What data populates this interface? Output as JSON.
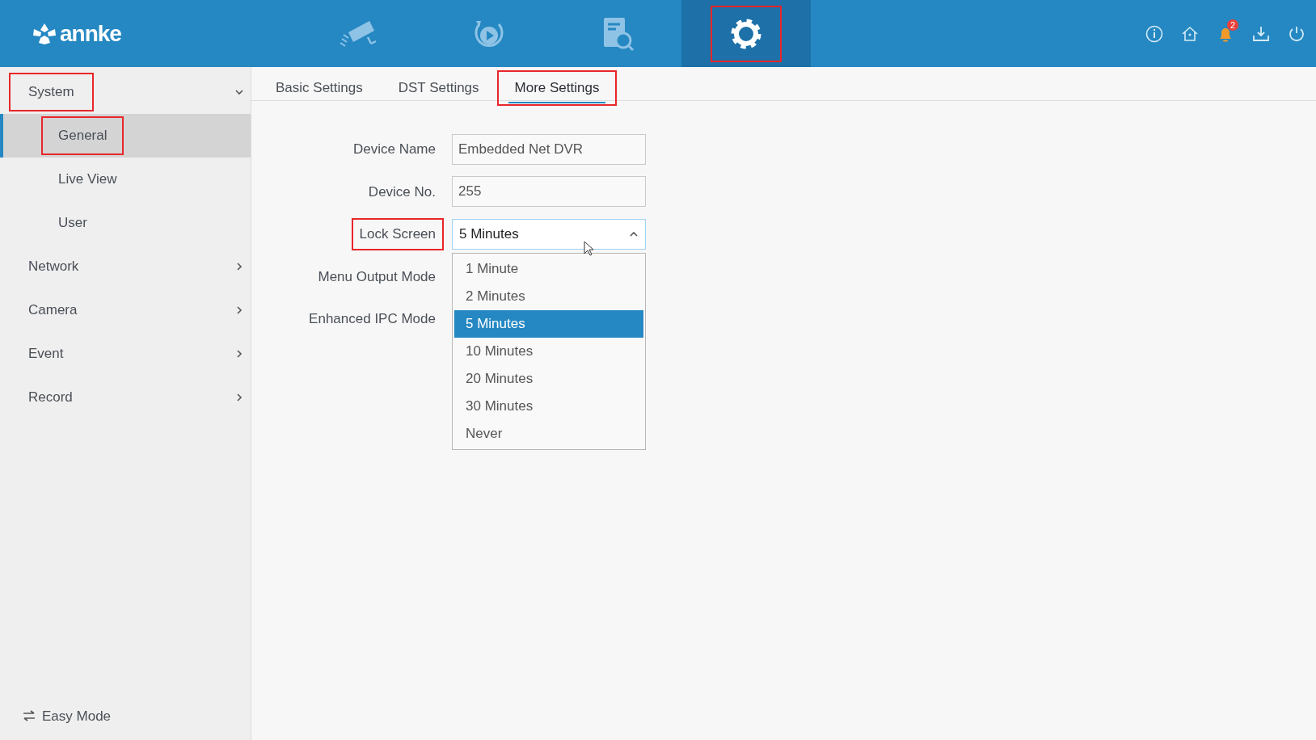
{
  "header": {
    "logo": "annke",
    "nav": [
      {
        "kind": "camera",
        "selected": false,
        "highlighted": false
      },
      {
        "kind": "playback",
        "selected": false,
        "highlighted": false
      },
      {
        "kind": "search",
        "selected": false,
        "highlighted": false
      },
      {
        "kind": "settings",
        "selected": true,
        "highlighted": true
      }
    ],
    "tools": [
      {
        "kind": "info"
      },
      {
        "kind": "home"
      },
      {
        "kind": "bell",
        "badge": "2"
      },
      {
        "kind": "download"
      },
      {
        "kind": "power"
      }
    ]
  },
  "sidebar": {
    "items": [
      {
        "label": "System",
        "expanded": true,
        "highlighted": true,
        "children": [
          {
            "label": "General",
            "selected": true,
            "highlighted": true
          },
          {
            "label": "Live View",
            "selected": false,
            "highlighted": false
          },
          {
            "label": "User",
            "selected": false,
            "highlighted": false
          }
        ]
      },
      {
        "label": "Network",
        "expanded": false,
        "highlighted": false
      },
      {
        "label": "Camera",
        "expanded": false,
        "highlighted": false
      },
      {
        "label": "Event",
        "expanded": false,
        "highlighted": false
      },
      {
        "label": "Record",
        "expanded": false,
        "highlighted": false
      }
    ],
    "footer": "Easy Mode"
  },
  "tabs": [
    {
      "label": "Basic Settings",
      "selected": false,
      "highlighted": false
    },
    {
      "label": "DST Settings",
      "selected": false,
      "highlighted": false
    },
    {
      "label": "More Settings",
      "selected": true,
      "highlighted": true
    }
  ],
  "form": {
    "fields": [
      {
        "label": "Device Name",
        "kind": "text",
        "value": "Embedded Net DVR",
        "highlighted": false
      },
      {
        "label": "Device No.",
        "kind": "text",
        "value": "255",
        "highlighted": false
      },
      {
        "label": "Lock Screen",
        "kind": "select",
        "value": "5 Minutes",
        "expanded": true,
        "highlighted": true,
        "options": [
          {
            "label": "1 Minute",
            "selected": false
          },
          {
            "label": "2 Minutes",
            "selected": false
          },
          {
            "label": "5 Minutes",
            "selected": true
          },
          {
            "label": "10 Minutes",
            "selected": false
          },
          {
            "label": "20 Minutes",
            "selected": false
          },
          {
            "label": "30 Minutes",
            "selected": false
          },
          {
            "label": "Never",
            "selected": false
          }
        ]
      },
      {
        "label": "Menu Output Mode",
        "kind": "label",
        "highlighted": false
      },
      {
        "label": "Enhanced IPC Mode",
        "kind": "label",
        "highlighted": false
      }
    ]
  }
}
